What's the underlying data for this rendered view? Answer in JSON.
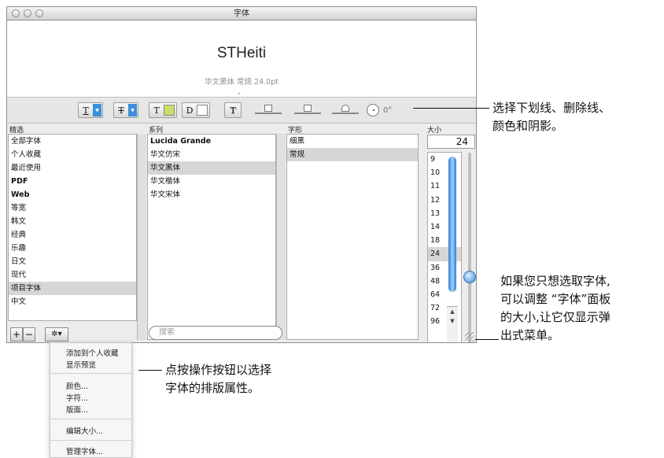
{
  "window": {
    "title": "字体"
  },
  "preview": {
    "font_name": "STHeiti",
    "font_desc": "华文黑体 常规 24.0pt"
  },
  "toolbar": {
    "underline": "T",
    "strike": "T",
    "text_color": "T",
    "doc_color": "D",
    "shadow": "T",
    "shadow_angle": "0°",
    "text_swatch": "#c8e06a",
    "doc_swatch": "#ffffff",
    "accent": "#3d8fdc",
    "icons": [
      "underline-icon",
      "strikethrough-icon",
      "text-color-icon",
      "document-color-icon",
      "shadow-icon"
    ]
  },
  "columns": {
    "collections": "精选",
    "family": "系列",
    "typeface": "字形",
    "size": "大小"
  },
  "collections": [
    "全部字体",
    "个人收藏",
    "最近使用",
    "PDF",
    "Web",
    "等宽",
    "韩文",
    "经典",
    "乐趣",
    "日文",
    "现代",
    "项目字体",
    "中文"
  ],
  "families": [
    "Lucida Grande",
    "华文仿宋",
    "华文黑体",
    "华文楷体",
    "华文宋体"
  ],
  "typefaces": [
    "细黑",
    "常规"
  ],
  "size": {
    "value": "24",
    "list": [
      "9",
      "10",
      "11",
      "12",
      "13",
      "14",
      "18",
      "24",
      "36",
      "48",
      "64",
      "72",
      "96"
    ]
  },
  "bottom": {
    "add": "+",
    "remove": "−",
    "gear": "✲▾",
    "search_placeholder": "搜索"
  },
  "menu": {
    "items": [
      "添加到个人收藏",
      "显示预览",
      "颜色...",
      "字符...",
      "版面...",
      "编辑大小...",
      "管理字体..."
    ]
  },
  "callouts": {
    "toolbar": [
      "选择下划线、删除线、",
      "颜色和阴影。"
    ],
    "resize": [
      "如果您只想选取字体,",
      "可以调整 “字体”面板",
      "的大小,让它仅显示弹",
      "出式菜单。"
    ],
    "action": [
      "点按操作按钮以选择",
      "字体的排版属性。"
    ]
  }
}
